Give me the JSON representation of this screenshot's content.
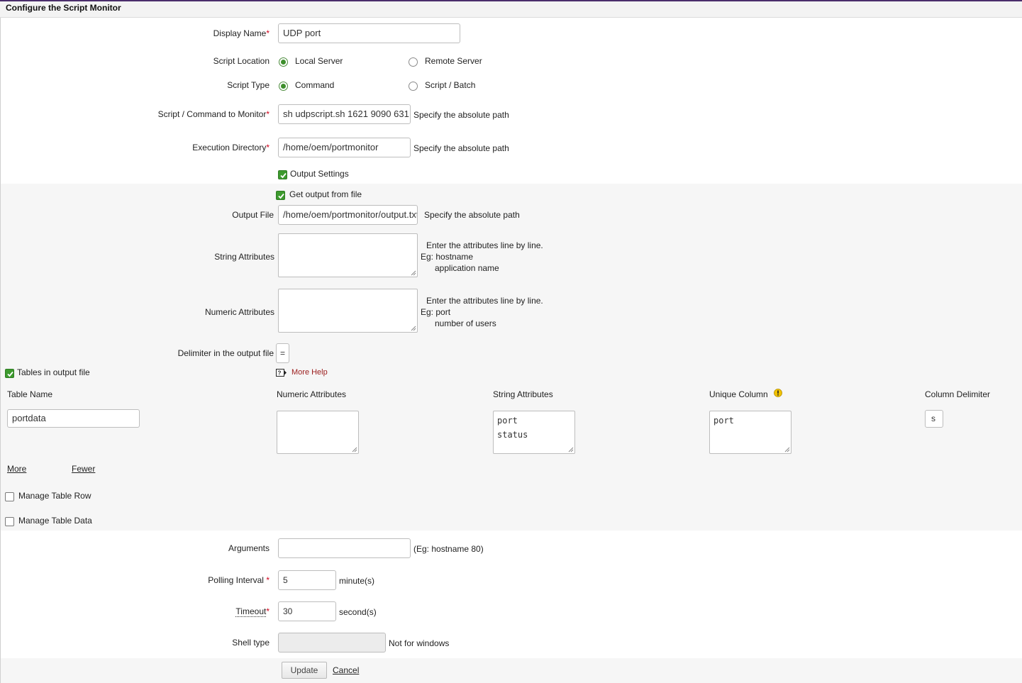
{
  "header": {
    "title": "Configure the Script Monitor"
  },
  "form": {
    "display_name": {
      "label": "Display Name",
      "value": "UDP port"
    },
    "script_location": {
      "label": "Script Location",
      "opt_local": "Local Server",
      "opt_remote": "Remote Server"
    },
    "script_type": {
      "label": "Script Type",
      "opt_command": "Command",
      "opt_script": "Script / Batch"
    },
    "script_command": {
      "label": "Script / Command to Monitor",
      "value": "sh udpscript.sh 1621 9090 631",
      "hint": "Specify the absolute path"
    },
    "exec_dir": {
      "label": "Execution Directory",
      "value": "/home/oem/portmonitor",
      "hint": "Specify the absolute path"
    },
    "output_settings": {
      "label": "Output Settings"
    },
    "get_output": {
      "label": "Get output from file"
    },
    "output_file": {
      "label": "Output File",
      "value": "/home/oem/portmonitor/output.txt",
      "hint": "Specify the absolute path"
    },
    "string_attrs": {
      "label": "String Attributes",
      "help1": "Enter the attributes line by line.",
      "help2": "Eg: hostname",
      "help3": "application name"
    },
    "numeric_attrs": {
      "label": "Numeric Attributes",
      "help1": "Enter the attributes line by line.",
      "help2": "Eg: port",
      "help3": "number of users"
    },
    "delimiter": {
      "label": "Delimiter in the output file",
      "value": "="
    },
    "tables": {
      "label": "Tables in output file",
      "more_help": "More Help"
    },
    "table_headers": {
      "table_name": "Table Name",
      "numeric": "Numeric Attributes",
      "string": "String Attributes",
      "unique": "Unique Column",
      "col_delim": "Column Delimiter"
    },
    "table_row": {
      "table_name": "portdata",
      "string": "port\nstatus",
      "unique": "port",
      "col_delim": "s"
    },
    "more_link": "More",
    "fewer_link": "Fewer",
    "manage_row": "Manage Table Row",
    "manage_data": "Manage Table Data",
    "arguments": {
      "label": "Arguments",
      "hint": "(Eg: hostname 80)"
    },
    "polling": {
      "label": "Polling Interval",
      "value": "5",
      "unit": "minute(s)"
    },
    "timeout": {
      "label": "Timeout",
      "value": "30",
      "unit": "second(s)"
    },
    "shell": {
      "label": "Shell type",
      "hint": "Not for windows"
    },
    "required_mark": "*"
  },
  "buttons": {
    "update": "Update",
    "cancel": "Cancel"
  }
}
